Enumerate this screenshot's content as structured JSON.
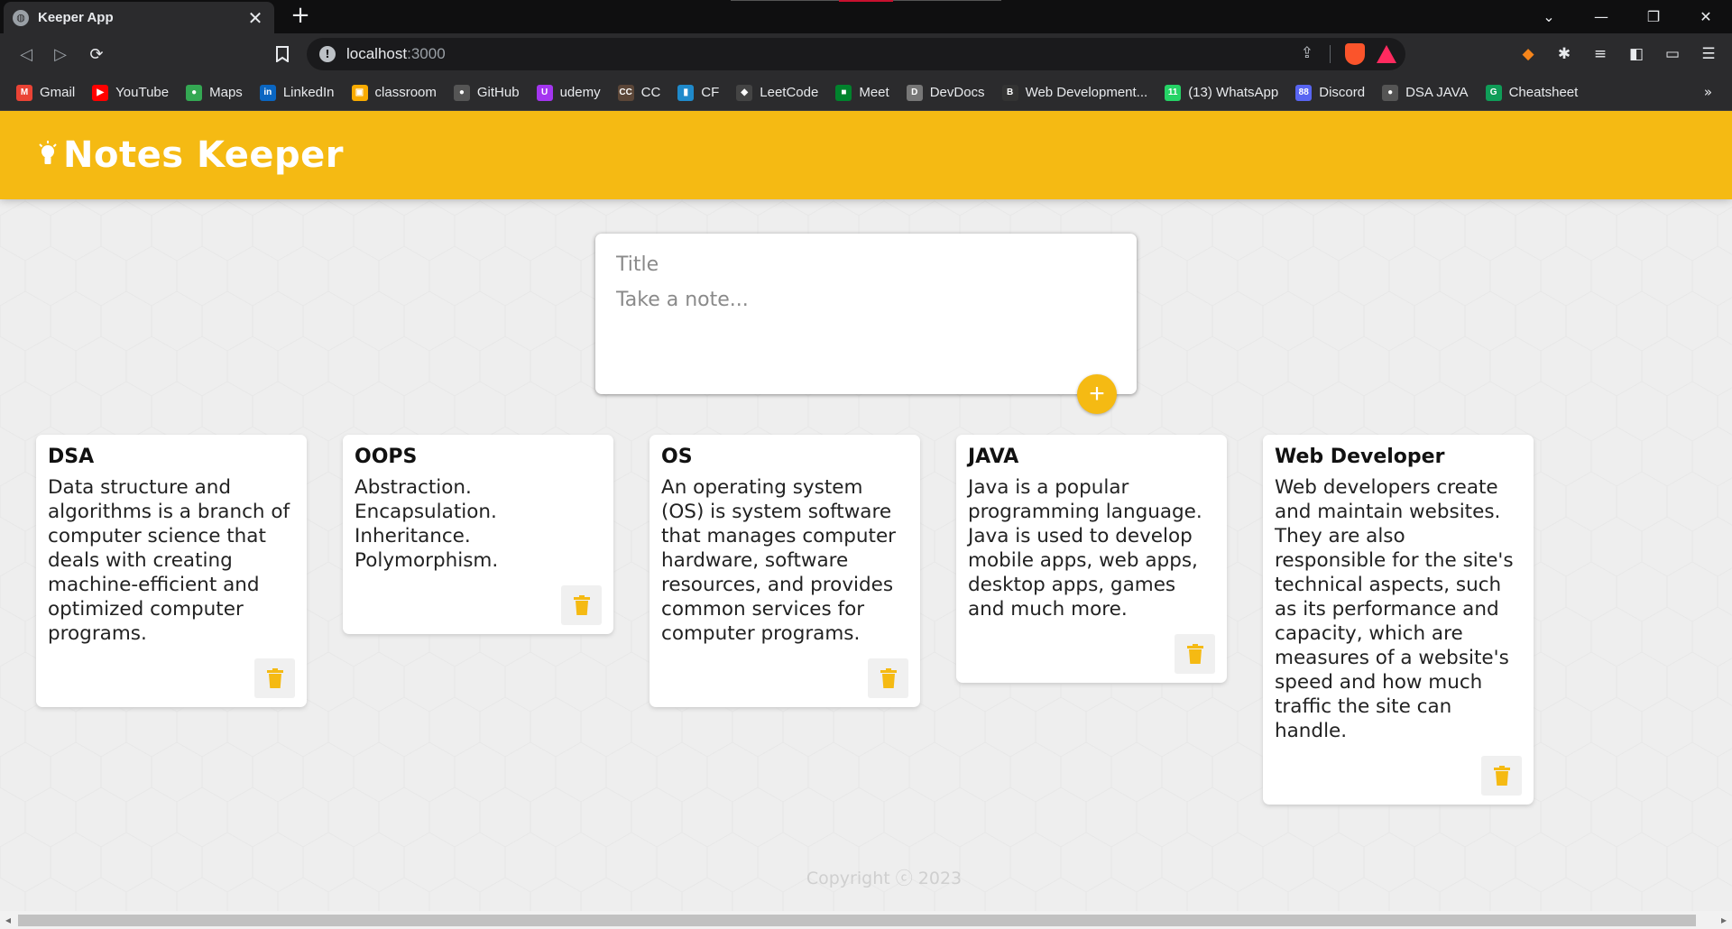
{
  "browser": {
    "tab_title": "Keeper App",
    "tab_close": "✕",
    "new_tab": "+",
    "window_controls": [
      "⌄",
      "—",
      "❐",
      "✕"
    ],
    "nav": {
      "back": "◁",
      "forward": "▷",
      "reload": "⟳",
      "bookmark": "🔖"
    },
    "address_host": "localhost",
    "address_port": ":3000",
    "bookmarks": [
      {
        "label": "Gmail",
        "icon": "gmail-icon",
        "glyph": "M",
        "color": "#ea4335"
      },
      {
        "label": "YouTube",
        "icon": "youtube-icon",
        "glyph": "▶",
        "color": "#ff0000"
      },
      {
        "label": "Maps",
        "icon": "maps-icon",
        "glyph": "●",
        "color": "#34a853"
      },
      {
        "label": "LinkedIn",
        "icon": "linkedin-icon",
        "glyph": "in",
        "color": "#0a66c2"
      },
      {
        "label": "classroom",
        "icon": "classroom-icon",
        "glyph": "▣",
        "color": "#f9ab00"
      },
      {
        "label": "GitHub",
        "icon": "github-icon",
        "glyph": "●",
        "color": "#555555"
      },
      {
        "label": "udemy",
        "icon": "udemy-icon",
        "glyph": "U",
        "color": "#a435f0"
      },
      {
        "label": "CC",
        "icon": "codechef-icon",
        "glyph": "CC",
        "color": "#5b4638"
      },
      {
        "label": "CF",
        "icon": "codeforces-icon",
        "glyph": "▮",
        "color": "#1f8acb"
      },
      {
        "label": "LeetCode",
        "icon": "leetcode-icon",
        "glyph": "◆",
        "color": "#444444"
      },
      {
        "label": "Meet",
        "icon": "meet-icon",
        "glyph": "■",
        "color": "#00832d"
      },
      {
        "label": "DevDocs",
        "icon": "devdocs-icon",
        "glyph": "D",
        "color": "#777777"
      },
      {
        "label": "Web Development...",
        "icon": "webdev-icon",
        "glyph": "B",
        "color": "#333333"
      },
      {
        "label": "(13) WhatsApp",
        "icon": "whatsapp-icon",
        "glyph": "11",
        "color": "#25d366"
      },
      {
        "label": "Discord",
        "icon": "discord-icon",
        "glyph": "88",
        "color": "#5865f2"
      },
      {
        "label": "DSA JAVA",
        "icon": "github-icon",
        "glyph": "●",
        "color": "#555555"
      },
      {
        "label": "Cheatsheet",
        "icon": "cheatsheet-icon",
        "glyph": "G",
        "color": "#0f9d58"
      }
    ],
    "bookmarks_more": "»"
  },
  "app": {
    "title": "Notes Keeper",
    "accent": "#f5ba13",
    "create": {
      "title_placeholder": "Title",
      "content_placeholder": "Take a note...",
      "add_label": "+"
    },
    "notes": [
      {
        "title": "DSA",
        "content": "Data structure and algorithms is a branch of computer science that deals with creating machine-efficient and optimized computer programs."
      },
      {
        "title": "OOPS",
        "content": "Abstraction. Encapsulation. Inheritance. Polymorphism."
      },
      {
        "title": "OS",
        "content": "An operating system (OS) is system software that manages computer hardware, software resources, and provides common services for computer programs."
      },
      {
        "title": "JAVA",
        "content": "Java is a popular programming language. Java is used to develop mobile apps, web apps, desktop apps, games and much more."
      },
      {
        "title": "Web Developer",
        "content": "Web developers create and maintain websites. They are also responsible for the site's technical aspects, such as its performance and capacity, which are measures of a website's speed and how much traffic the site can handle."
      }
    ],
    "footer": "Copyright ⓒ 2023"
  }
}
